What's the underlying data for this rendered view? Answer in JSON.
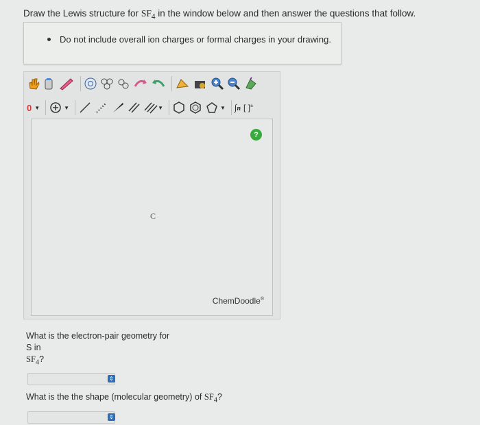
{
  "question": {
    "prompt_pre": "Draw the Lewis structure for ",
    "formula_base": "SF",
    "formula_sub": "4",
    "prompt_post": " in the window below and then answer the questions that follow.",
    "note": "Do not include overall ion charges or formal charges in your drawing."
  },
  "editor": {
    "charge_value": "0",
    "canvas_atom": "C",
    "help_label": "?",
    "brand": "ChemDoodle",
    "brand_mark": "®",
    "icons": [
      "hand-icon",
      "eraser-icon",
      "pencil-icon",
      "ring-template-icon",
      "copy-icon",
      "transform-icon",
      "undo-icon",
      "redo-icon",
      "clean-icon",
      "open-icon",
      "zoom-in-icon",
      "zoom-out-icon",
      "flip-icon",
      "charge-dropdown",
      "plus-charge-icon",
      "single-bond-icon",
      "dashed-bond-icon",
      "wedge-bond-icon",
      "double-bond-icon",
      "triple-bond-icon",
      "hexagon-icon",
      "benzene-icon",
      "pentagon-icon",
      "sn-icon",
      "bracket-icon"
    ]
  },
  "q1": {
    "line1": "What is the electron-pair geometry for",
    "line2": "S in",
    "formula_base": "SF",
    "formula_sub": "4",
    "suffix": "?"
  },
  "q2": {
    "text": "What is the the shape (molecular geometry) of ",
    "formula_base": "SF",
    "formula_sub": "4",
    "suffix": "?"
  },
  "colors": {
    "accent_blue": "#2f6fb8",
    "help_green": "#3aa93e"
  }
}
